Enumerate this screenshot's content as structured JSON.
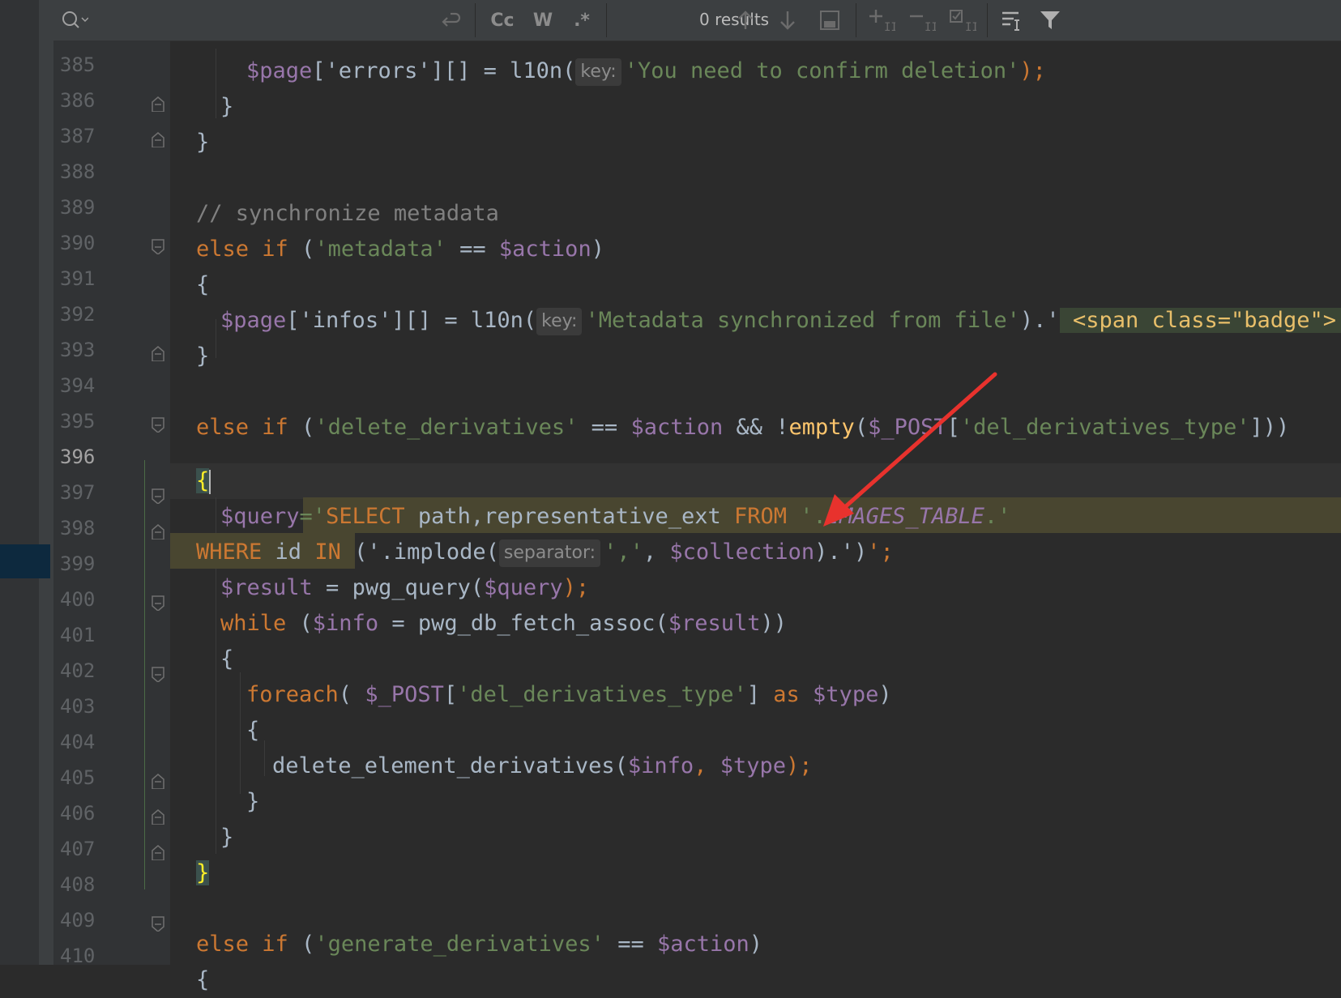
{
  "toolbar": {
    "search_icon": "search-icon",
    "results_text": "0 results",
    "match_case_label": "Cc",
    "words_label": "W",
    "regex_label": ".*"
  },
  "lines": [
    {
      "n": "385"
    },
    {
      "n": "386"
    },
    {
      "n": "387"
    },
    {
      "n": "388"
    },
    {
      "n": "389"
    },
    {
      "n": "390"
    },
    {
      "n": "391"
    },
    {
      "n": "392"
    },
    {
      "n": "393"
    },
    {
      "n": "394"
    },
    {
      "n": "395"
    },
    {
      "n": "396"
    },
    {
      "n": "397"
    },
    {
      "n": "398"
    },
    {
      "n": "399"
    },
    {
      "n": "400"
    },
    {
      "n": "401"
    },
    {
      "n": "402"
    },
    {
      "n": "403"
    },
    {
      "n": "404"
    },
    {
      "n": "405"
    },
    {
      "n": "406"
    },
    {
      "n": "407"
    },
    {
      "n": "408"
    },
    {
      "n": "409"
    },
    {
      "n": "410"
    }
  ],
  "code": {
    "l385": {
      "a": "$page",
      "b": "['errors'][] = l10n(",
      "hint": "key:",
      "c": "'You need to confirm deletion'",
      "d": ");"
    },
    "l386": "}",
    "l387": "}",
    "l389": "// synchronize metadata",
    "l390": {
      "kw": "else if",
      "a": " (",
      "s": "'metadata'",
      "b": " == ",
      "v": "$action",
      "c": ")"
    },
    "l391": "{",
    "l392": {
      "a": "$page",
      "b": "['infos'][] = l10n(",
      "hint": "key:",
      "s": "'Metadata synchronized from file'",
      "c": ").'",
      "tag": " <span class=\"badge\">'"
    },
    "l393": "}",
    "l395": {
      "kw": "else if",
      "a": " (",
      "s": "'delete_derivatives'",
      "b": " == ",
      "v": "$action",
      "c": " && !",
      "fn": "empty",
      "d": "(",
      "v2": "$_POST",
      "e": "[",
      "s2": "'del_derivatives_type'",
      "f": "]))"
    },
    "l396": "{",
    "l397": {
      "v": "$query",
      "a": "='",
      "sql1": "SELECT ",
      "sql2": "path,representative_ext ",
      "sql3": "FROM ",
      "b": "'.",
      "const": "IMAGES_TABLE",
      "c": ".'"
    },
    "l398": {
      "sql1": "WHERE ",
      "sql2": "id ",
      "sql3": "IN ",
      "a": "('.implode(",
      "hint": "separator:",
      "s": "','",
      "b": ", ",
      "v": "$collection",
      "c": ").')",
      "d": "';"
    },
    "l399": {
      "v": "$result",
      "a": " = pwg_query(",
      "v2": "$query",
      "b": ");"
    },
    "l400": {
      "kw": "while",
      "a": " (",
      "v": "$info",
      "b": " = pwg_db_fetch_assoc(",
      "v2": "$result",
      "c": "))"
    },
    "l401": "{",
    "l402": {
      "kw": "foreach",
      "a": "( ",
      "v": "$_POST",
      "b": "[",
      "s": "'del_derivatives_type'",
      "c": "] ",
      "kw2": "as",
      "d": " ",
      "v2": "$type",
      "e": ")"
    },
    "l403": "{",
    "l404": {
      "a": "delete_element_derivatives(",
      "v": "$info",
      "b": ", ",
      "v2": "$type",
      "c": ");"
    },
    "l405": "}",
    "l406": "}",
    "l407": "}",
    "l409": {
      "kw": "else if",
      "a": " (",
      "s": "'generate_derivatives'",
      "b": " == ",
      "v": "$action",
      "c": ")"
    },
    "l410": "{"
  },
  "colors": {
    "annotation_arrow": "#e8322d"
  }
}
